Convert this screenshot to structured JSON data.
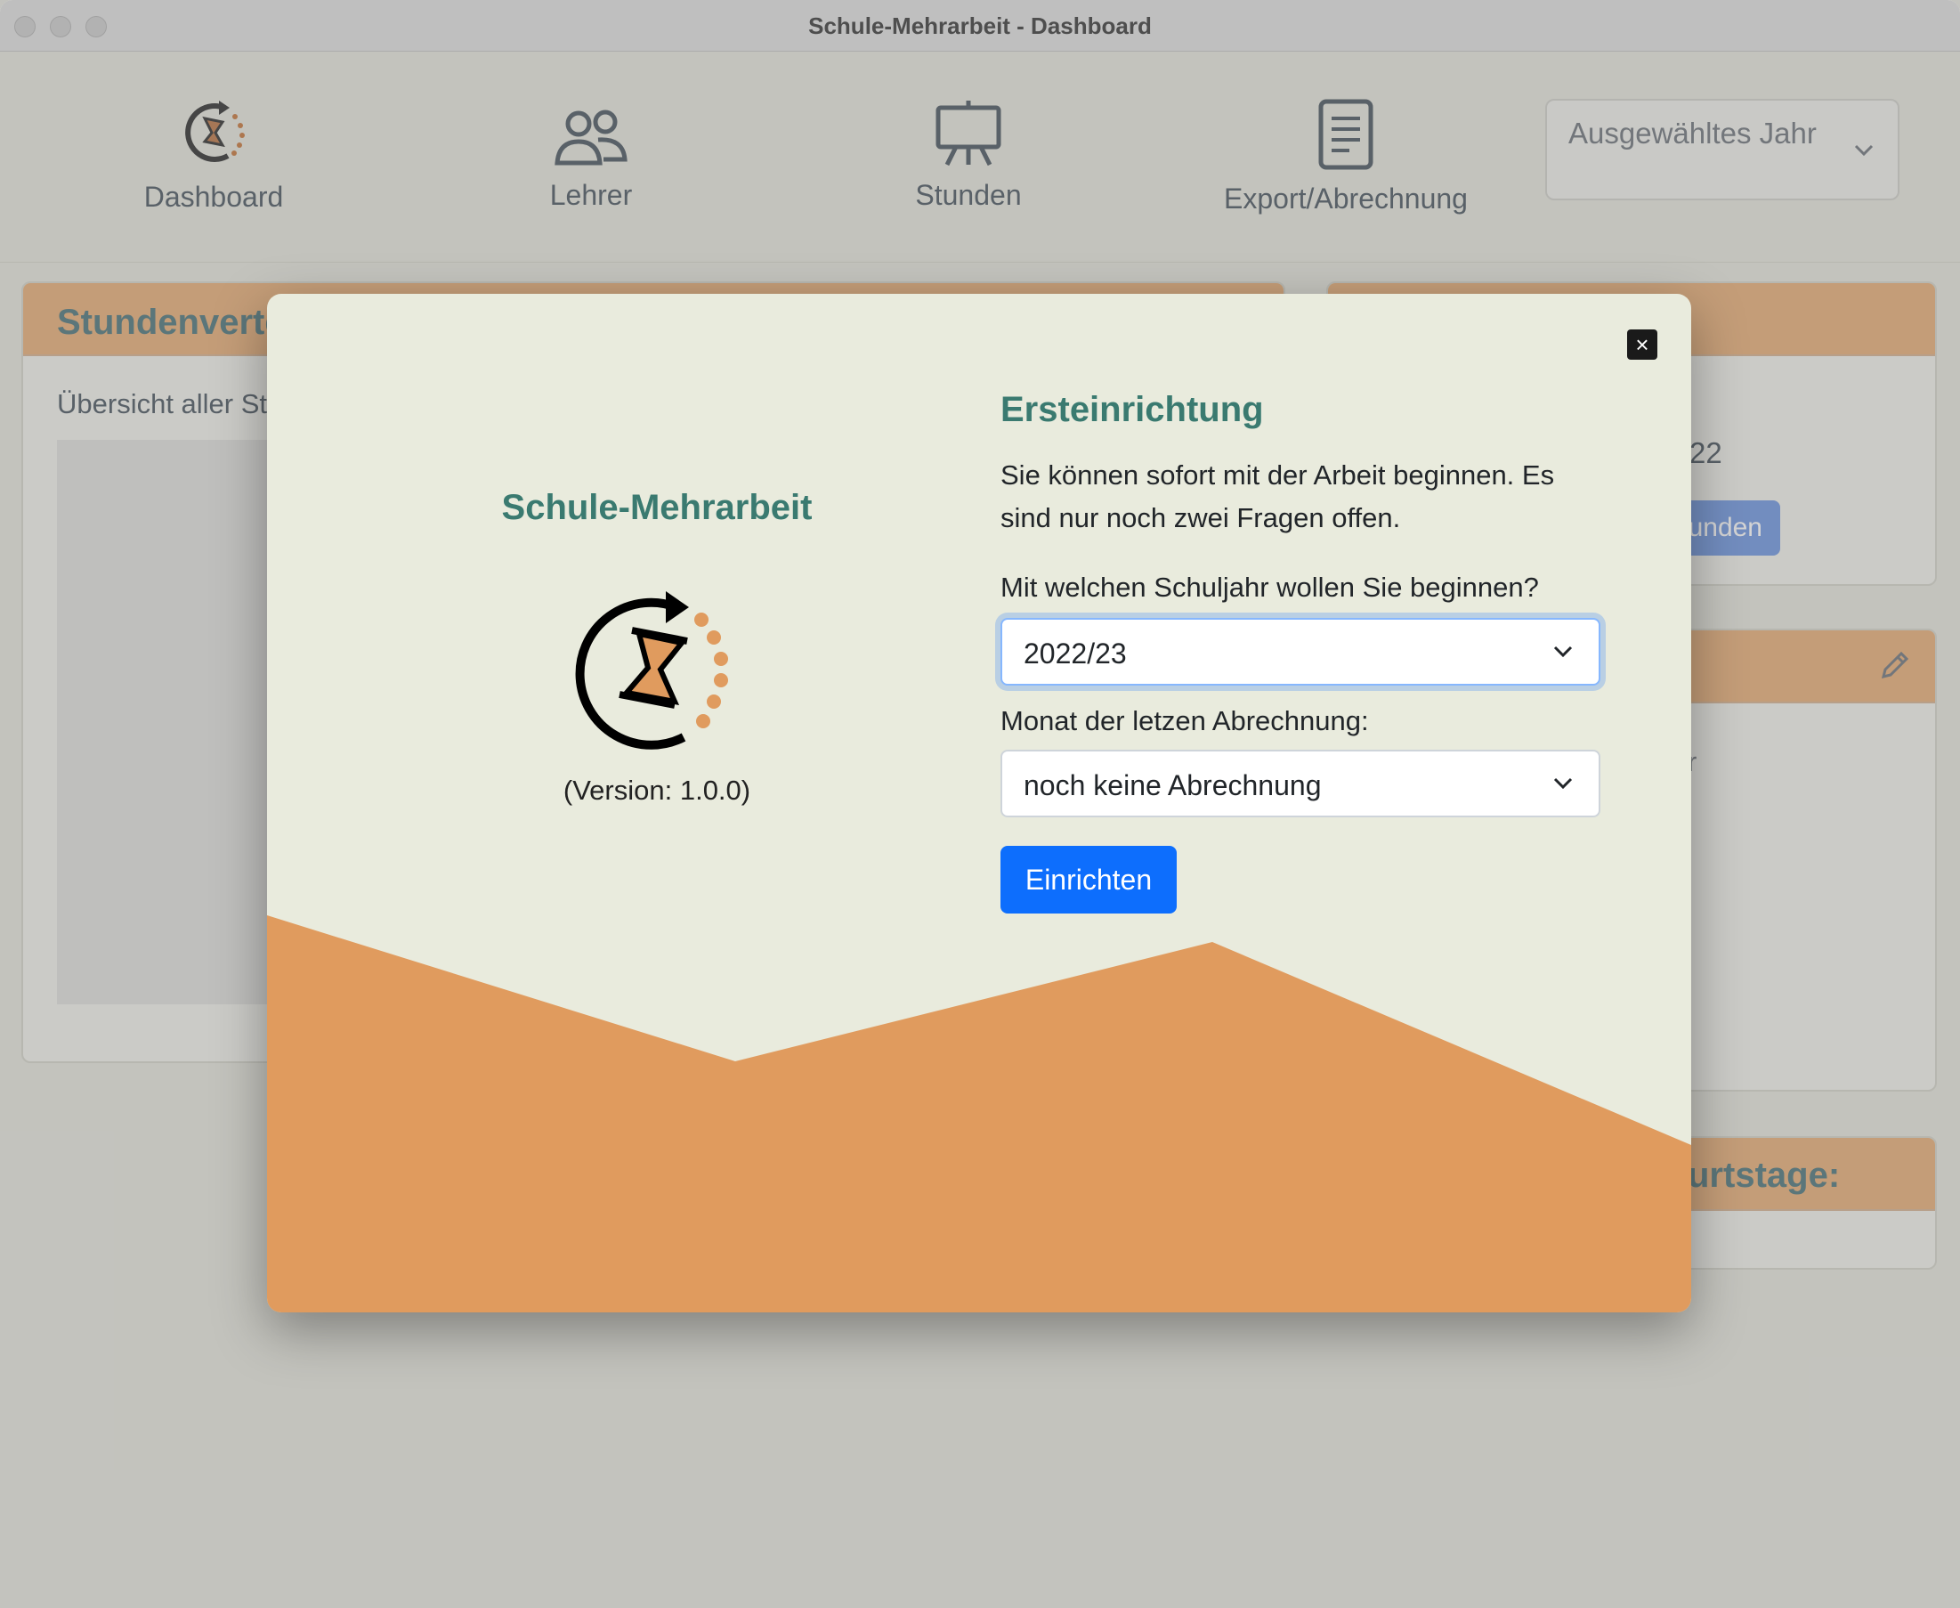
{
  "window": {
    "title": "Schule-Mehrarbeit - Dashboard"
  },
  "nav": {
    "items": [
      {
        "label": "Dashboard",
        "icon": "hourglass-logo-icon"
      },
      {
        "label": "Lehrer",
        "icon": "people-icon"
      },
      {
        "label": "Stunden",
        "icon": "easel-icon"
      },
      {
        "label": "Export/Abrechnung",
        "icon": "document-icon"
      }
    ],
    "year_select": {
      "label": "Ausgewähltes Jahr"
    }
  },
  "background": {
    "card1": {
      "title": "Stundenverte",
      "subtitle": "Übersicht aller St"
    },
    "card2": {
      "text": "22",
      "button": "tunden"
    },
    "card3": {
      "stray_text": "r"
    },
    "card4": {
      "title": "urtstage:"
    }
  },
  "modal": {
    "close_label": "×",
    "app_name": "Schule-Mehrarbeit",
    "version": "(Version: 1.0.0)",
    "setup": {
      "title": "Ersteinrichtung",
      "text": "Sie können sofort mit der Arbeit beginnen. Es sind nur noch zwei Fragen offen.",
      "year_label": "Mit welchen Schuljahr wollen Sie beginnen?",
      "year_value": "2022/23",
      "month_label": "Monat der letzen Abrechnung:",
      "month_value": "noch keine Abrechnung",
      "submit_label": "Einrichten"
    }
  },
  "colors": {
    "accent_orange": "#e09b5e",
    "header_orange": "#ecbd91",
    "teal_heading": "#3a7a70",
    "primary_blue": "#0d6efd",
    "modal_bg": "#e9ebdd"
  }
}
